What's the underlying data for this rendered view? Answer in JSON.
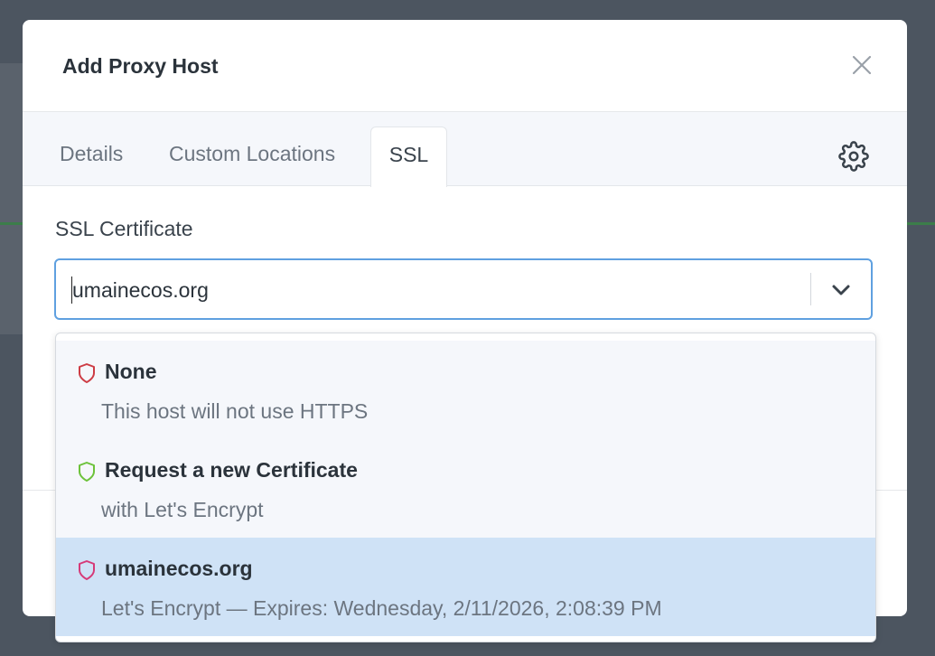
{
  "modal": {
    "title": "Add Proxy Host",
    "tabs": [
      {
        "label": "Details"
      },
      {
        "label": "Custom Locations"
      },
      {
        "label": "SSL"
      }
    ],
    "active_tab": "SSL"
  },
  "ssl": {
    "label": "SSL Certificate",
    "selected_value": "umainecos.org",
    "options": [
      {
        "title": "None",
        "subtitle": "This host will not use HTTPS",
        "icon": "shield-icon",
        "color": "#cd3c44"
      },
      {
        "title": "Request a new Certificate",
        "subtitle": "with Let's Encrypt",
        "icon": "shield-icon",
        "color": "#6cc23a"
      },
      {
        "title": "umainecos.org",
        "subtitle": "Let's Encrypt — Expires: Wednesday, 2/11/2026, 2:08:39 PM",
        "icon": "shield-icon",
        "color": "#d63a78"
      }
    ],
    "highlighted_option": "umainecos.org"
  },
  "colors": {
    "accent_border": "#5fa0e0",
    "highlight": "#cfe2f6",
    "overlay": "#4c5560"
  }
}
